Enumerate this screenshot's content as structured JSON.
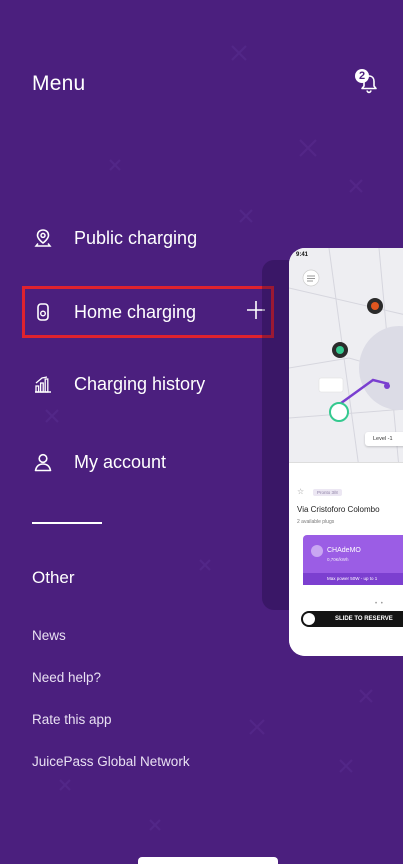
{
  "menu": {
    "title": "Menu",
    "notification_count": "2"
  },
  "nav": {
    "items": [
      {
        "label": "Public charging",
        "icon": "location-pin-icon"
      },
      {
        "label": "Home charging",
        "icon": "wallbox-icon",
        "highlighted": true
      },
      {
        "label": "Charging history",
        "icon": "bar-chart-icon"
      },
      {
        "label": "My account",
        "icon": "user-icon"
      }
    ],
    "expand_icon": "plus-icon"
  },
  "other": {
    "title": "Other",
    "links": [
      "News",
      "Need help?",
      "Rate this app",
      "JuicePass Global Network"
    ]
  },
  "preview": {
    "time": "9:41",
    "level_label": "Level -1",
    "tag_label": "Pronto 3/8",
    "address": "Via Cristoforo Colombo",
    "plugs": "2 available plugs",
    "connector_name": "CHAdeMO",
    "connector_price": "0,70€/kWh",
    "connector_power": "Max power 50W - up to 1",
    "slide_label": "SLIDE TO RESERVE"
  },
  "colors": {
    "background": "#4b1f7e",
    "highlight_border": "#e0222e",
    "accent": "#9b5de5"
  }
}
